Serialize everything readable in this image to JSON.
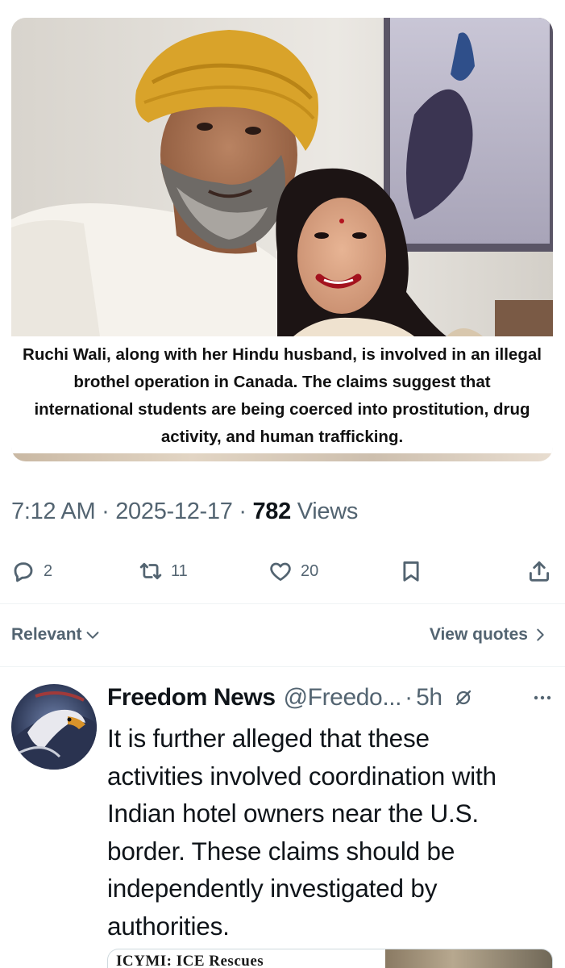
{
  "media": {
    "caption": "Ruchi Wali, along with her Hindu husband, is involved in an illegal brothel operation in Canada. The claims suggest that international students are being coerced into prostitution, drug activity, and human trafficking."
  },
  "post_meta": {
    "time": "7:12 AM",
    "separator": "·",
    "date": "2025-12-17",
    "views_count": "782",
    "views_label": "Views"
  },
  "actions": {
    "replies": "2",
    "reposts": "11",
    "likes": "20"
  },
  "sort": {
    "relevant_label": "Relevant",
    "view_quotes_label": "View quotes"
  },
  "reply": {
    "author_name": "Freedom News",
    "author_handle": "@Freedo...",
    "separator": "·",
    "time": "5h",
    "text_lines": [
      "It is further alleged that these",
      "activities involved coordination with",
      "Indian hotel owners near the U.S.",
      "border. These claims should be",
      "independently investigated by",
      "authorities."
    ],
    "card_title_peek": "ICYMI: ICE Rescues"
  },
  "colors": {
    "text_primary": "#0f1419",
    "text_secondary": "#536471",
    "divider": "#eff3f4",
    "turban": "#d9a32a"
  },
  "icons": {
    "reply": "reply-bubble-icon",
    "repost": "repost-arrows-icon",
    "like": "heart-icon",
    "bookmark": "bookmark-icon",
    "share": "share-upload-icon",
    "relevant_chevron": "chevron-down-icon",
    "view_quotes_chevron": "chevron-right-icon",
    "grok": "grok-slash-icon",
    "more": "more-dots-icon"
  }
}
